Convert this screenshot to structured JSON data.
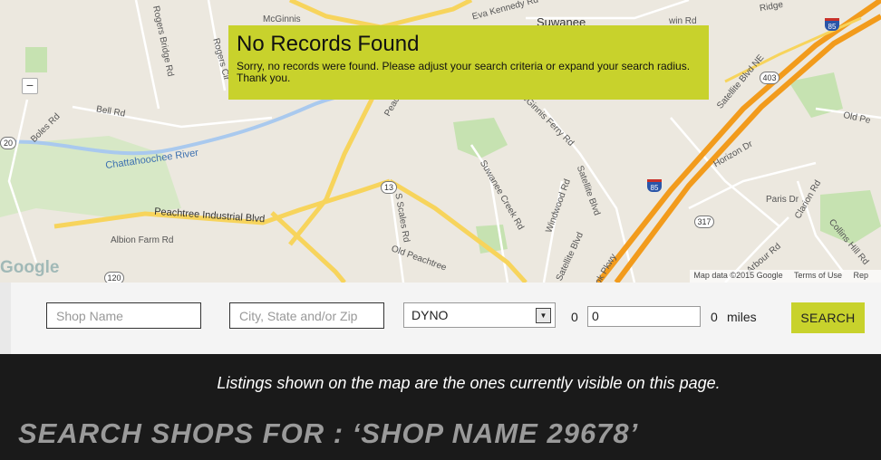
{
  "map": {
    "labels": {
      "mcginnis_top": "McGinnis",
      "eva_kennedy": "Eva Kennedy Rd",
      "suwanee": "Suwanee",
      "rogers_bridge": "Rogers Bridge Rd",
      "rogers_cir": "Rogers Cir",
      "bell": "Bell Rd",
      "boles": "Boles Rd",
      "river": "Chattahoochee River",
      "peachtree_ind": "Peachtree Industrial Blvd",
      "albion": "Albion Farm Rd",
      "old_peachtree": "Old Peachtree",
      "s_scales": "S Scales Rd",
      "suwanee_creek": "Suwanee Creek Rd",
      "windwood": "Windwood Rd",
      "satellite_blvd": "Satellite Blvd",
      "satellite_blvd_ne": "Satellite Blvd NE",
      "mcginnis_ferry": "McGinnis Ferry Rd",
      "horizon": "Horizon Dr",
      "old_pe_right": "Old Pe",
      "paris": "Paris Dr",
      "clarion": "Clarion Rd",
      "collins_hill": "Collins Hill Rd",
      "arbour": "Arbour Rd",
      "ridge": "Ridge",
      "ok_pkwy": "ok Pkwy",
      "peach_top": "Peach",
      "win_rd": "win Rd"
    },
    "shields": {
      "r20": "20",
      "r13": "13",
      "r120": "120",
      "r317": "317",
      "r403": "403",
      "i85a": "85",
      "i85b": "85"
    },
    "zoom_out": "−",
    "google_logo": "Google",
    "attribution": {
      "data": "Map data ©2015 Google",
      "terms": "Terms of Use",
      "report": "Rep"
    }
  },
  "notice": {
    "title": "No Records Found",
    "message": "Sorry, no records were found. Please adjust your search criteria or expand your search radius. Thank you."
  },
  "search": {
    "shop_name_placeholder": "Shop Name",
    "location_placeholder": "City, State and/or Zip",
    "category_selected": "DYNO",
    "min_radius": "0",
    "radius_value": "0",
    "max_radius": "0",
    "units": "miles",
    "button_label": "SEARCH"
  },
  "footer": {
    "listing_note": "Listings shown on the map are the ones currently visible on this page.",
    "heading": "SEARCH SHOPS FOR : ‘SHOP NAME 29678’"
  },
  "colors": {
    "accent": "#c8d22c",
    "interstate": "#f29b1c",
    "road_yellow": "#f7d45c",
    "water": "#a9c9ee",
    "park": "#c6e2b1"
  }
}
